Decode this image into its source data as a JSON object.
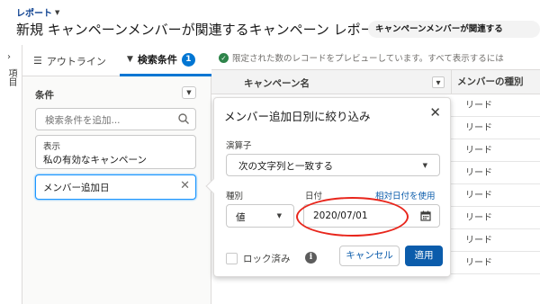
{
  "header": {
    "reports_link": "レポート",
    "title": "新規 キャンペーンメンバーが関連するキャンペーン レポート",
    "report_type_badge": "キャンペーンメンバーが関連する"
  },
  "rail": {
    "label": "項目"
  },
  "panel": {
    "tabs": [
      {
        "label": "アウトライン"
      },
      {
        "label": "検索条件",
        "count": "1"
      }
    ],
    "conditions_label": "条件",
    "search_placeholder": "検索条件を追加...",
    "filters": [
      {
        "key": "表示",
        "value": "私の有効なキャンペーン"
      },
      {
        "value": "メンバー追加日"
      }
    ]
  },
  "preview": {
    "note": "限定された数のレコードをプレビューしています。すべて表示するには",
    "columns": [
      "キャンペーン名",
      "メンバーの種別"
    ],
    "rows": [
      "リード",
      "リード",
      "リード",
      "リード",
      "リード",
      "リード",
      "リード",
      "リード"
    ]
  },
  "popover": {
    "title": "メンバー追加日別に絞り込み",
    "operator_label": "演算子",
    "operator_value": "次の文字列と一致する",
    "type_label": "種別",
    "type_value": "値",
    "date_label": "日付",
    "relative_link": "相対日付を使用",
    "date_value": "2020/07/01",
    "locked_label": "ロック済み",
    "cancel_label": "キャンセル",
    "apply_label": "適用"
  },
  "colors": {
    "brand_blue": "#0176d3",
    "button_blue": "#0b5cab",
    "annotation_red": "#e8261c",
    "success_green": "#2e844a"
  }
}
